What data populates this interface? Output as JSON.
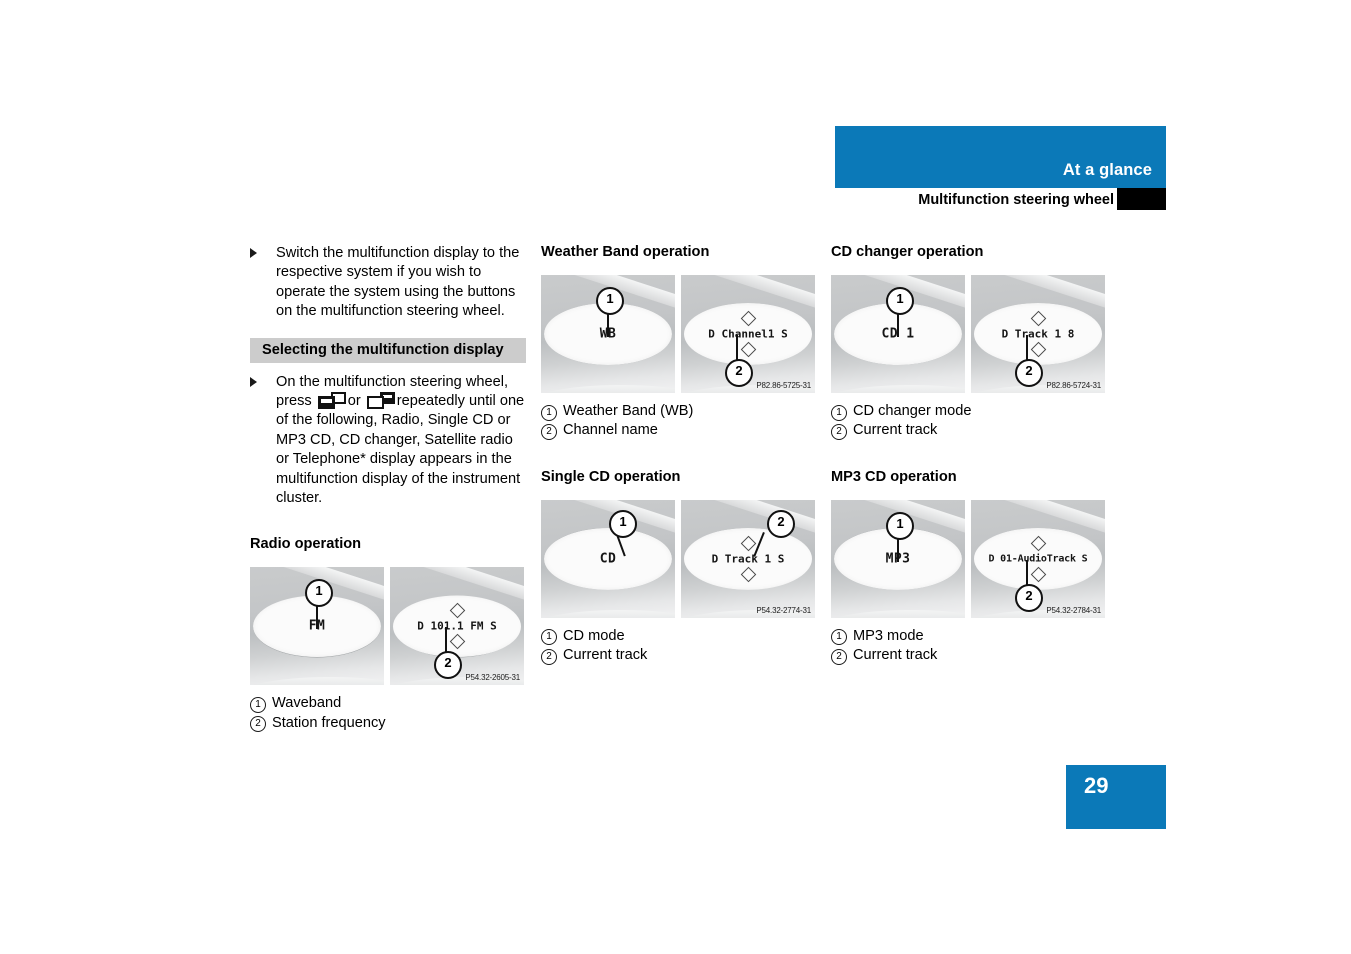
{
  "header": {
    "title": "At a glance",
    "subtitle": "Multifunction steering wheel",
    "band_color": "#0b79b8",
    "tab_color": "#000000"
  },
  "footer": {
    "page_number": "29",
    "badge_color": "#0b79b8"
  },
  "left_column": {
    "intro_bullet": "Switch the multifunction display to the respective system if you wish to operate the system using the buttons on the multifunction steering wheel.",
    "gray_heading": "Selecting the multifunction display",
    "instruction_pre": "On the multifunction steering wheel, press",
    "instruction_or": "or",
    "instruction_post": "repeatedly until one of the following, Radio, Single CD or MP3 CD, CD changer, Satellite radio or Telephone* display appears in the multifunction display of the instrument cluster.",
    "button_icon_left": "mfsw-display-left-icon",
    "button_icon_right": "mfsw-display-right-icon",
    "radio": {
      "heading": "Radio operation",
      "left_display": "FM",
      "right_display": "D 101.1 FM   S",
      "photo_id": "P54.32-2605-31",
      "legend": [
        {
          "num": "1",
          "text": "Waveband"
        },
        {
          "num": "2",
          "text": "Station frequency"
        }
      ]
    }
  },
  "middle_column": {
    "weather_band": {
      "heading": "Weather Band operation",
      "left_display": "WB",
      "right_display": "D Channel1 S",
      "photo_id": "P82.86-5725-31",
      "legend": [
        {
          "num": "1",
          "text": "Weather Band (WB)"
        },
        {
          "num": "2",
          "text": "Channel name"
        }
      ]
    },
    "single_cd": {
      "heading": "Single CD operation",
      "left_display": "CD",
      "right_display": "D  Track 1  S",
      "photo_id": "P54.32-2774-31",
      "legend": [
        {
          "num": "1",
          "text": "CD mode"
        },
        {
          "num": "2",
          "text": "Current track"
        }
      ]
    }
  },
  "right_column": {
    "cd_changer": {
      "heading": "CD changer operation",
      "left_display": "CD 1",
      "right_display": "D  Track 1   8",
      "photo_id": "P82.86-5724-31",
      "legend": [
        {
          "num": "1",
          "text": "CD changer mode"
        },
        {
          "num": "2",
          "text": "Current track"
        }
      ]
    },
    "mp3_cd": {
      "heading": "MP3 CD operation",
      "left_display": "MP3",
      "right_display": "D 01-AudioTrack S",
      "photo_id": "P54.32-2784-31",
      "legend": [
        {
          "num": "1",
          "text": "MP3 mode"
        },
        {
          "num": "2",
          "text": "Current track"
        }
      ]
    }
  }
}
